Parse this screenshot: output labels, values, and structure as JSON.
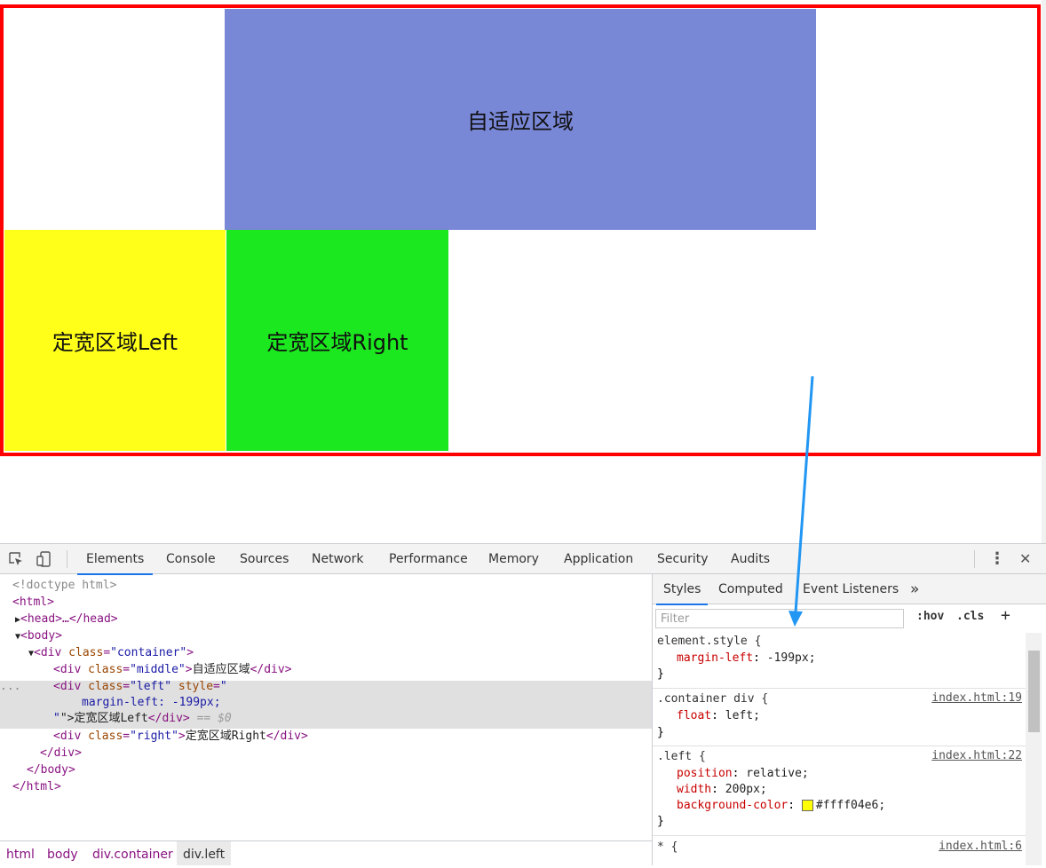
{
  "page": {
    "middle_text": "自适应区域",
    "left_text": "定宽区域Left",
    "right_text": "定宽区域Right",
    "colors": {
      "border": "#ff0000",
      "middle_bg": "#7987d7",
      "left_bg": "#ffff1a",
      "right_bg": "#1be81e",
      "arrow": "#2196f3"
    }
  },
  "devtools": {
    "tabs": [
      "Elements",
      "Console",
      "Sources",
      "Network",
      "Performance",
      "Memory",
      "Application",
      "Security",
      "Audits"
    ],
    "active_tab": "Elements",
    "more_icon": "⋮",
    "close_icon": "✕",
    "dom": {
      "doctype": "<!doctype html>",
      "html_open": "<html>",
      "head_collapsed": "<head>…</head>",
      "body_open": "<body>",
      "div_container_open_tag": "div",
      "div_container_attr": "class",
      "div_container_val": "\"container\"",
      "middle_tag": "div",
      "middle_attr": "class",
      "middle_val": "\"middle\"",
      "middle_text": "自适应区域",
      "left_attr1": "class",
      "left_val1": "\"left\"",
      "left_attr2": "style",
      "left_style_line": "margin-left: -199px;",
      "left_text": "\">定宽区域Left",
      "left_close": "</div>",
      "dollar_zero": " == $0",
      "right_val": "\"right\"",
      "right_text": "定宽区域Right",
      "div_close": "</div>",
      "body_close": "</body>",
      "html_close": "</html>",
      "ellipsis": "..."
    },
    "breadcrumbs": [
      "html",
      "body",
      "div.container",
      "div.left"
    ],
    "styles_tabs": [
      "Styles",
      "Computed",
      "Event Listeners"
    ],
    "styles_more": "»",
    "filter_placeholder": "Filter",
    "hov_label": ":hov",
    "cls_label": ".cls",
    "add_label": "+",
    "rules": [
      {
        "selector": "element.style {",
        "source": "",
        "props": [
          {
            "name": "margin-left",
            "value": "-199px;"
          }
        ]
      },
      {
        "selector": ".container div {",
        "source": "index.html:19",
        "props": [
          {
            "name": "float",
            "value": "left;"
          }
        ]
      },
      {
        "selector": ".left {",
        "source": "index.html:22",
        "props": [
          {
            "name": "position",
            "value": "relative;"
          },
          {
            "name": "width",
            "value": "200px;"
          },
          {
            "name": "background-color",
            "value": "#ffff04e6;",
            "swatch": "#ffff04"
          }
        ]
      },
      {
        "selector": "* {",
        "source": "index.html:6",
        "props": []
      }
    ],
    "rule_close": "}"
  }
}
